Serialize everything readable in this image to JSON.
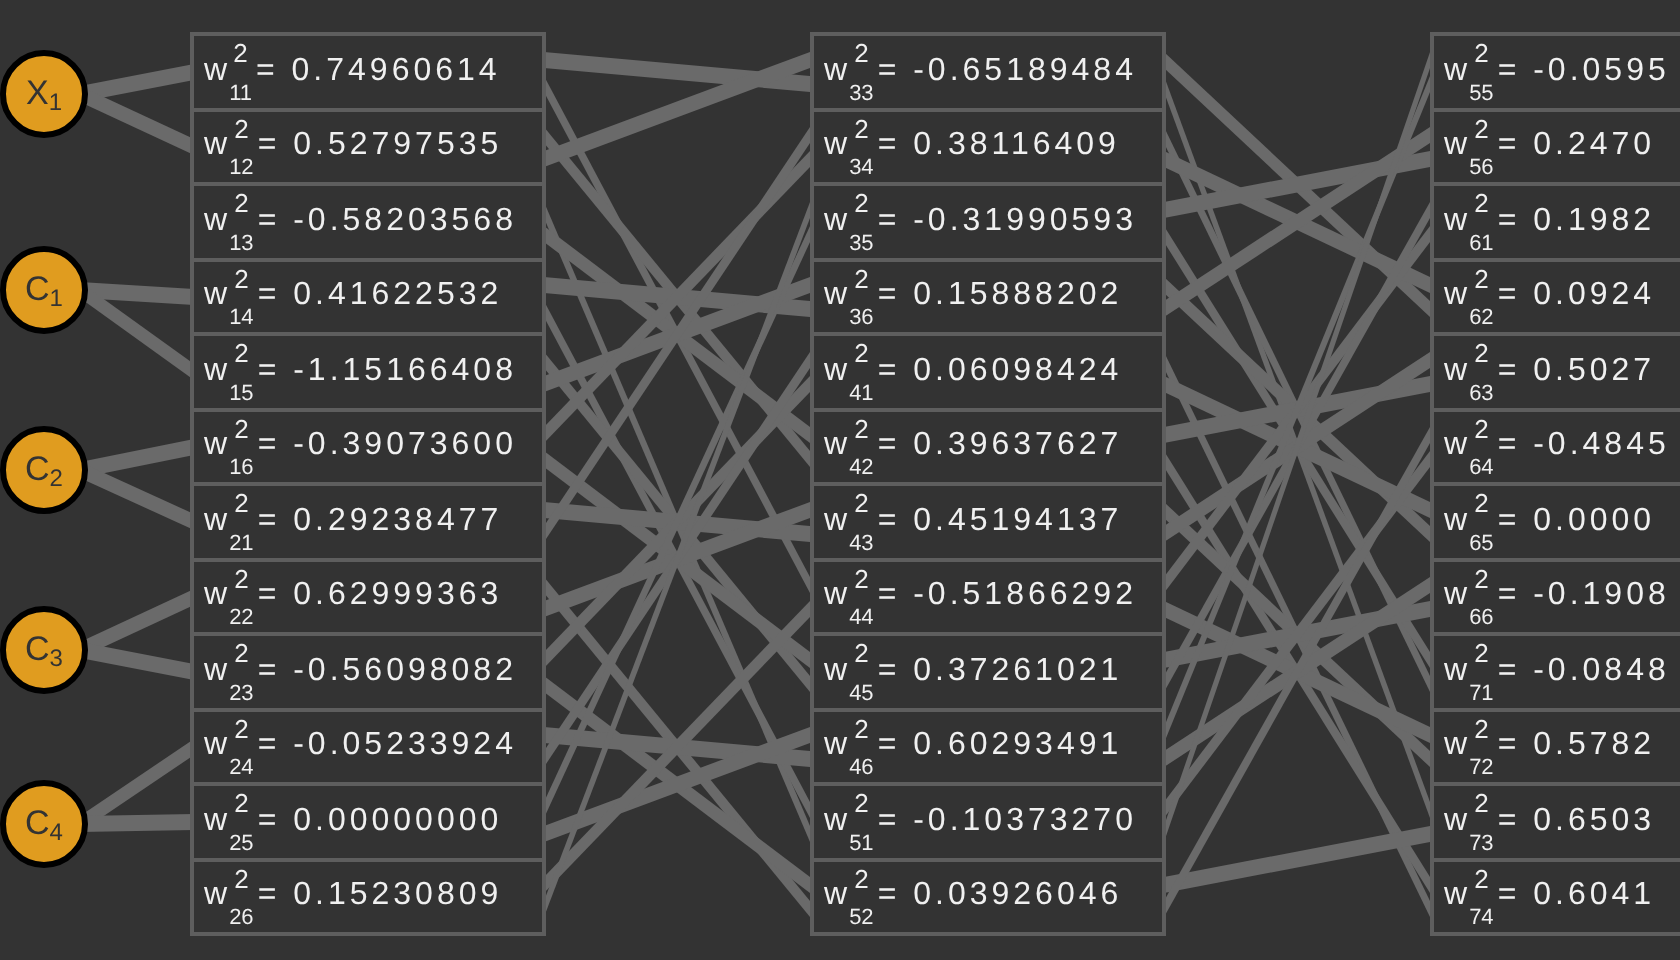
{
  "nodes": [
    {
      "symbol": "X",
      "subscript": "1"
    },
    {
      "symbol": "C",
      "subscript": "1"
    },
    {
      "symbol": "C",
      "subscript": "2"
    },
    {
      "symbol": "C",
      "subscript": "3"
    },
    {
      "symbol": "C",
      "subscript": "4"
    }
  ],
  "weight_columns": [
    [
      {
        "symbol": "w",
        "superscript": "2",
        "subscript": "11",
        "value": "= 0.74960614"
      },
      {
        "symbol": "w",
        "superscript": "2",
        "subscript": "12",
        "value": "= 0.52797535"
      },
      {
        "symbol": "w",
        "superscript": "2",
        "subscript": "13",
        "value": "= -0.58203568"
      },
      {
        "symbol": "w",
        "superscript": "2",
        "subscript": "14",
        "value": "= 0.41622532"
      },
      {
        "symbol": "w",
        "superscript": "2",
        "subscript": "15",
        "value": "= -1.15166408"
      },
      {
        "symbol": "w",
        "superscript": "2",
        "subscript": "16",
        "value": "= -0.39073600"
      },
      {
        "symbol": "w",
        "superscript": "2",
        "subscript": "21",
        "value": "= 0.29238477"
      },
      {
        "symbol": "w",
        "superscript": "2",
        "subscript": "22",
        "value": "= 0.62999363"
      },
      {
        "symbol": "w",
        "superscript": "2",
        "subscript": "23",
        "value": "= -0.56098082"
      },
      {
        "symbol": "w",
        "superscript": "2",
        "subscript": "24",
        "value": "= -0.05233924"
      },
      {
        "symbol": "w",
        "superscript": "2",
        "subscript": "25",
        "value": "= 0.00000000"
      },
      {
        "symbol": "w",
        "superscript": "2",
        "subscript": "26",
        "value": "= 0.15230809"
      }
    ],
    [
      {
        "symbol": "w",
        "superscript": "2",
        "subscript": "33",
        "value": "= -0.65189484"
      },
      {
        "symbol": "w",
        "superscript": "2",
        "subscript": "34",
        "value": "= 0.38116409"
      },
      {
        "symbol": "w",
        "superscript": "2",
        "subscript": "35",
        "value": "= -0.31990593"
      },
      {
        "symbol": "w",
        "superscript": "2",
        "subscript": "36",
        "value": "= 0.15888202"
      },
      {
        "symbol": "w",
        "superscript": "2",
        "subscript": "41",
        "value": "= 0.06098424"
      },
      {
        "symbol": "w",
        "superscript": "2",
        "subscript": "42",
        "value": "= 0.39637627"
      },
      {
        "symbol": "w",
        "superscript": "2",
        "subscript": "43",
        "value": "= 0.45194137"
      },
      {
        "symbol": "w",
        "superscript": "2",
        "subscript": "44",
        "value": "= -0.51866292"
      },
      {
        "symbol": "w",
        "superscript": "2",
        "subscript": "45",
        "value": "= 0.37261021"
      },
      {
        "symbol": "w",
        "superscript": "2",
        "subscript": "46",
        "value": "= 0.60293491"
      },
      {
        "symbol": "w",
        "superscript": "2",
        "subscript": "51",
        "value": "= -0.10373270"
      },
      {
        "symbol": "w",
        "superscript": "2",
        "subscript": "52",
        "value": "= 0.03926046"
      }
    ],
    [
      {
        "symbol": "w",
        "superscript": "2",
        "subscript": "55",
        "value": "= -0.0595"
      },
      {
        "symbol": "w",
        "superscript": "2",
        "subscript": "56",
        "value": "= 0.2470"
      },
      {
        "symbol": "w",
        "superscript": "2",
        "subscript": "61",
        "value": "= 0.1982"
      },
      {
        "symbol": "w",
        "superscript": "2",
        "subscript": "62",
        "value": "= 0.0924"
      },
      {
        "symbol": "w",
        "superscript": "2",
        "subscript": "63",
        "value": "= 0.5027"
      },
      {
        "symbol": "w",
        "superscript": "2",
        "subscript": "64",
        "value": "= -0.4845"
      },
      {
        "symbol": "w",
        "superscript": "2",
        "subscript": "65",
        "value": "= 0.0000"
      },
      {
        "symbol": "w",
        "superscript": "2",
        "subscript": "66",
        "value": "= -0.1908"
      },
      {
        "symbol": "w",
        "superscript": "2",
        "subscript": "71",
        "value": "= -0.0848"
      },
      {
        "symbol": "w",
        "superscript": "2",
        "subscript": "72",
        "value": "= 0.5782"
      },
      {
        "symbol": "w",
        "superscript": "2",
        "subscript": "73",
        "value": "= 0.6503"
      },
      {
        "symbol": "w",
        "superscript": "2",
        "subscript": "74",
        "value": "= 0.6041"
      }
    ]
  ]
}
